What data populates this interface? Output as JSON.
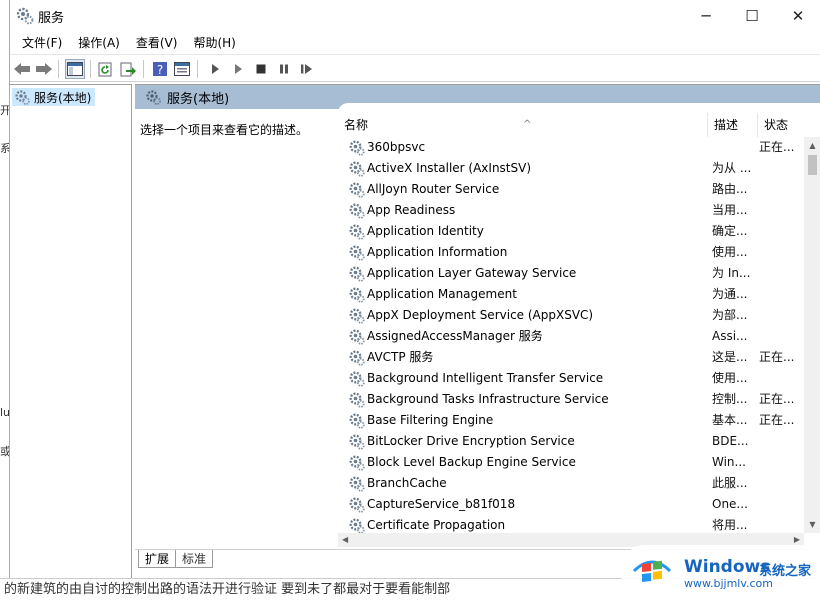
{
  "window": {
    "title": "服务"
  },
  "menu": [
    "文件(F)",
    "操作(A)",
    "查看(V)",
    "帮助(H)"
  ],
  "tree": {
    "item": "服务(本地)"
  },
  "pane": {
    "header": "服务(本地)",
    "description": "选择一个项目来查看它的描述。"
  },
  "columns": {
    "name": "名称",
    "desc": "描述",
    "status": "状态"
  },
  "services": [
    {
      "name": "360bpsvc",
      "desc": "",
      "status": "正在..."
    },
    {
      "name": "ActiveX Installer (AxInstSV)",
      "desc": "为从 ...",
      "status": ""
    },
    {
      "name": "AllJoyn Router Service",
      "desc": "路由...",
      "status": ""
    },
    {
      "name": "App Readiness",
      "desc": "当用...",
      "status": ""
    },
    {
      "name": "Application Identity",
      "desc": "确定...",
      "status": ""
    },
    {
      "name": "Application Information",
      "desc": "使用...",
      "status": ""
    },
    {
      "name": "Application Layer Gateway Service",
      "desc": "为 In...",
      "status": ""
    },
    {
      "name": "Application Management",
      "desc": "为通...",
      "status": ""
    },
    {
      "name": "AppX Deployment Service (AppXSVC)",
      "desc": "为部...",
      "status": ""
    },
    {
      "name": "AssignedAccessManager 服务",
      "desc": "Assi...",
      "status": ""
    },
    {
      "name": "AVCTP 服务",
      "desc": "这是...",
      "status": "正在..."
    },
    {
      "name": "Background Intelligent Transfer Service",
      "desc": "使用...",
      "status": ""
    },
    {
      "name": "Background Tasks Infrastructure Service",
      "desc": "控制...",
      "status": "正在..."
    },
    {
      "name": "Base Filtering Engine",
      "desc": "基本...",
      "status": "正在..."
    },
    {
      "name": "BitLocker Drive Encryption Service",
      "desc": "BDE...",
      "status": ""
    },
    {
      "name": "Block Level Backup Engine Service",
      "desc": "Win...",
      "status": ""
    },
    {
      "name": "BranchCache",
      "desc": "此服...",
      "status": ""
    },
    {
      "name": "CaptureService_b81f018",
      "desc": "One...",
      "status": ""
    },
    {
      "name": "Certificate Propagation",
      "desc": "将用...",
      "status": ""
    }
  ],
  "tabs": {
    "expanded": "扩展",
    "standard": "标准"
  },
  "watermark": {
    "title": "Windows",
    "cn": "系统之家",
    "url": "www.bjjmlv.com"
  },
  "background": {
    "left_fragments": [
      "开",
      "系",
      "lu",
      "或"
    ],
    "bottom_text": "的新建筑的由自讨的控制出路的语法开进行验证    要到未了都最对于要看能制部"
  },
  "colors": {
    "header_bar": "#a6bdd4",
    "selection": "#cce8ff",
    "watermark": "#1565c0"
  }
}
